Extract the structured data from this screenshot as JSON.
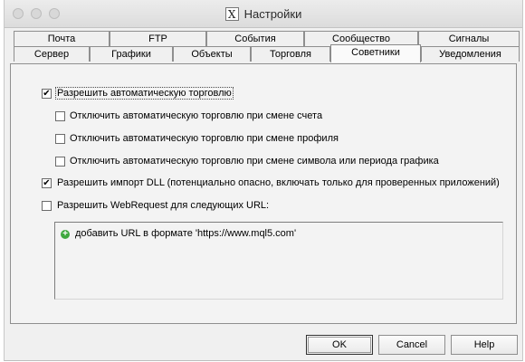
{
  "window": {
    "title": "Настройки",
    "app_icon_glyph": "X"
  },
  "tabs": {
    "row1": [
      "Почта",
      "FTP",
      "События",
      "Сообщество",
      "Сигналы"
    ],
    "row2": [
      "Сервер",
      "Графики",
      "Объекты",
      "Торговля",
      "Советники",
      "Уведомления"
    ],
    "active": "Советники"
  },
  "options": {
    "auto_trading": {
      "label": "Разрешить автоматическую торговлю",
      "checked": true
    },
    "disable_on_account": {
      "label": "Отключить автоматическую торговлю при смене счета",
      "checked": false
    },
    "disable_on_profile": {
      "label": "Отключить автоматическую торговлю при смене профиля",
      "checked": false
    },
    "disable_on_symbol": {
      "label": "Отключить автоматическую торговлю при смене символа или периода графика",
      "checked": false
    },
    "dll_import": {
      "label": "Разрешить импорт DLL (потенциально опасно, включать только для проверенных приложений)",
      "checked": true
    },
    "webrequest": {
      "label": "Разрешить WebRequest для следующих URL:",
      "checked": false
    }
  },
  "url_list": {
    "add_hint": "добавить URL в формате 'https://www.mql5.com'"
  },
  "buttons": {
    "ok": "OK",
    "cancel": "Cancel",
    "help": "Help"
  },
  "check_glyph": "✔",
  "colors": {
    "add_icon": "#3fa83f"
  }
}
